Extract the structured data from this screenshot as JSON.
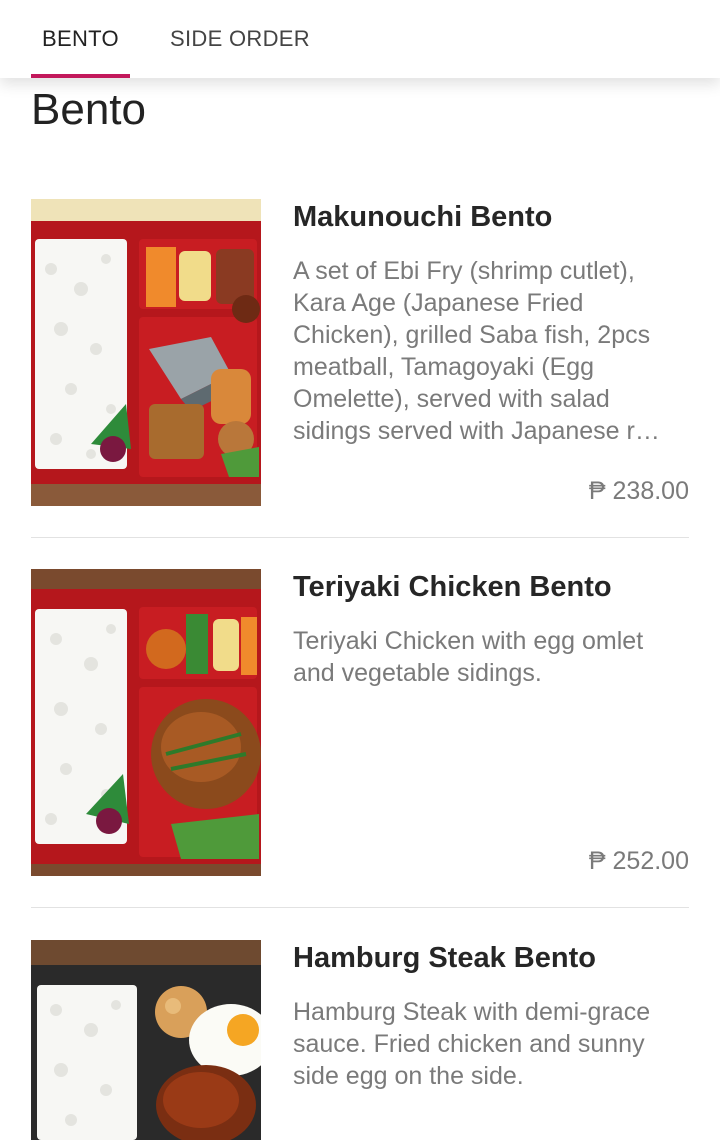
{
  "tabs": [
    {
      "label": "BENTO",
      "active": true
    },
    {
      "label": "SIDE ORDER",
      "active": false
    }
  ],
  "accent_color": "#c2185b",
  "section": {
    "title": "Bento"
  },
  "items": [
    {
      "name": "Makunouchi Bento",
      "description": "A set of Ebi Fry (shrimp cutlet), Kara Age (Japanese Fried Chicken), grilled Saba fish, 2pcs meatball, Tamagoyaki (Egg Omelette), served with salad sidings served with Japanese r…",
      "price": "₱ 238.00",
      "image": "makunouchi-bento-photo"
    },
    {
      "name": "Teriyaki Chicken Bento",
      "description": "Teriyaki Chicken  with egg omlet and vegetable sidings.",
      "price": "₱ 252.00",
      "image": "teriyaki-chicken-bento-photo"
    },
    {
      "name": "Hamburg Steak Bento",
      "description": "Hamburg Steak with demi-grace sauce. Fried chicken and sunny side egg on the side.",
      "image": "hamburg-steak-bento-photo"
    }
  ]
}
